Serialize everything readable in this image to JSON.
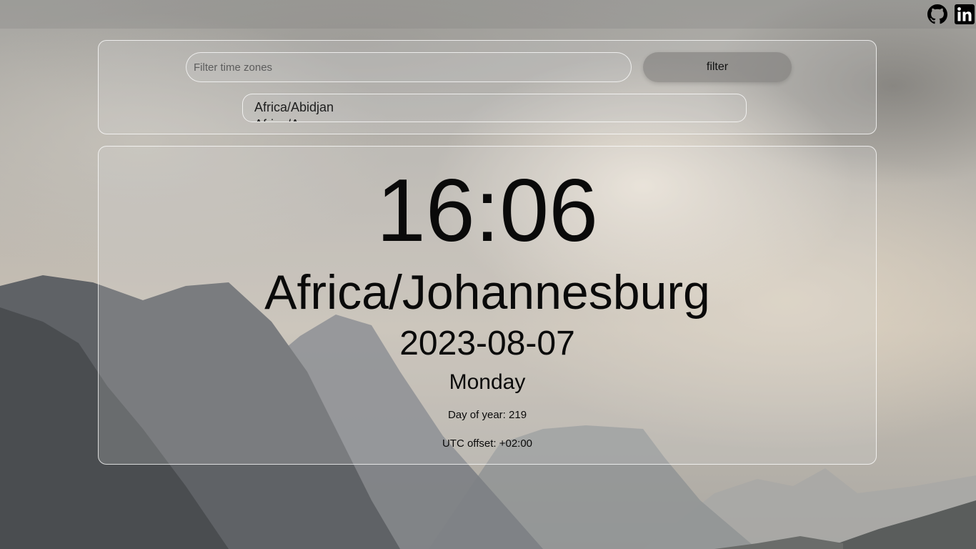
{
  "filter": {
    "placeholder": "Filter time zones",
    "button_label": "filter"
  },
  "timezone_list": {
    "options": [
      "Africa/Abidjan",
      "Africa/Accra"
    ]
  },
  "clock": {
    "time": "16:06",
    "zone": "Africa/Johannesburg",
    "date": "2023-08-07",
    "weekday": "Monday",
    "day_of_year": "Day of year: 219",
    "utc_offset": "UTC offset: +02:00"
  },
  "social": {
    "icons": [
      "github-icon",
      "linkedin-icon"
    ]
  }
}
